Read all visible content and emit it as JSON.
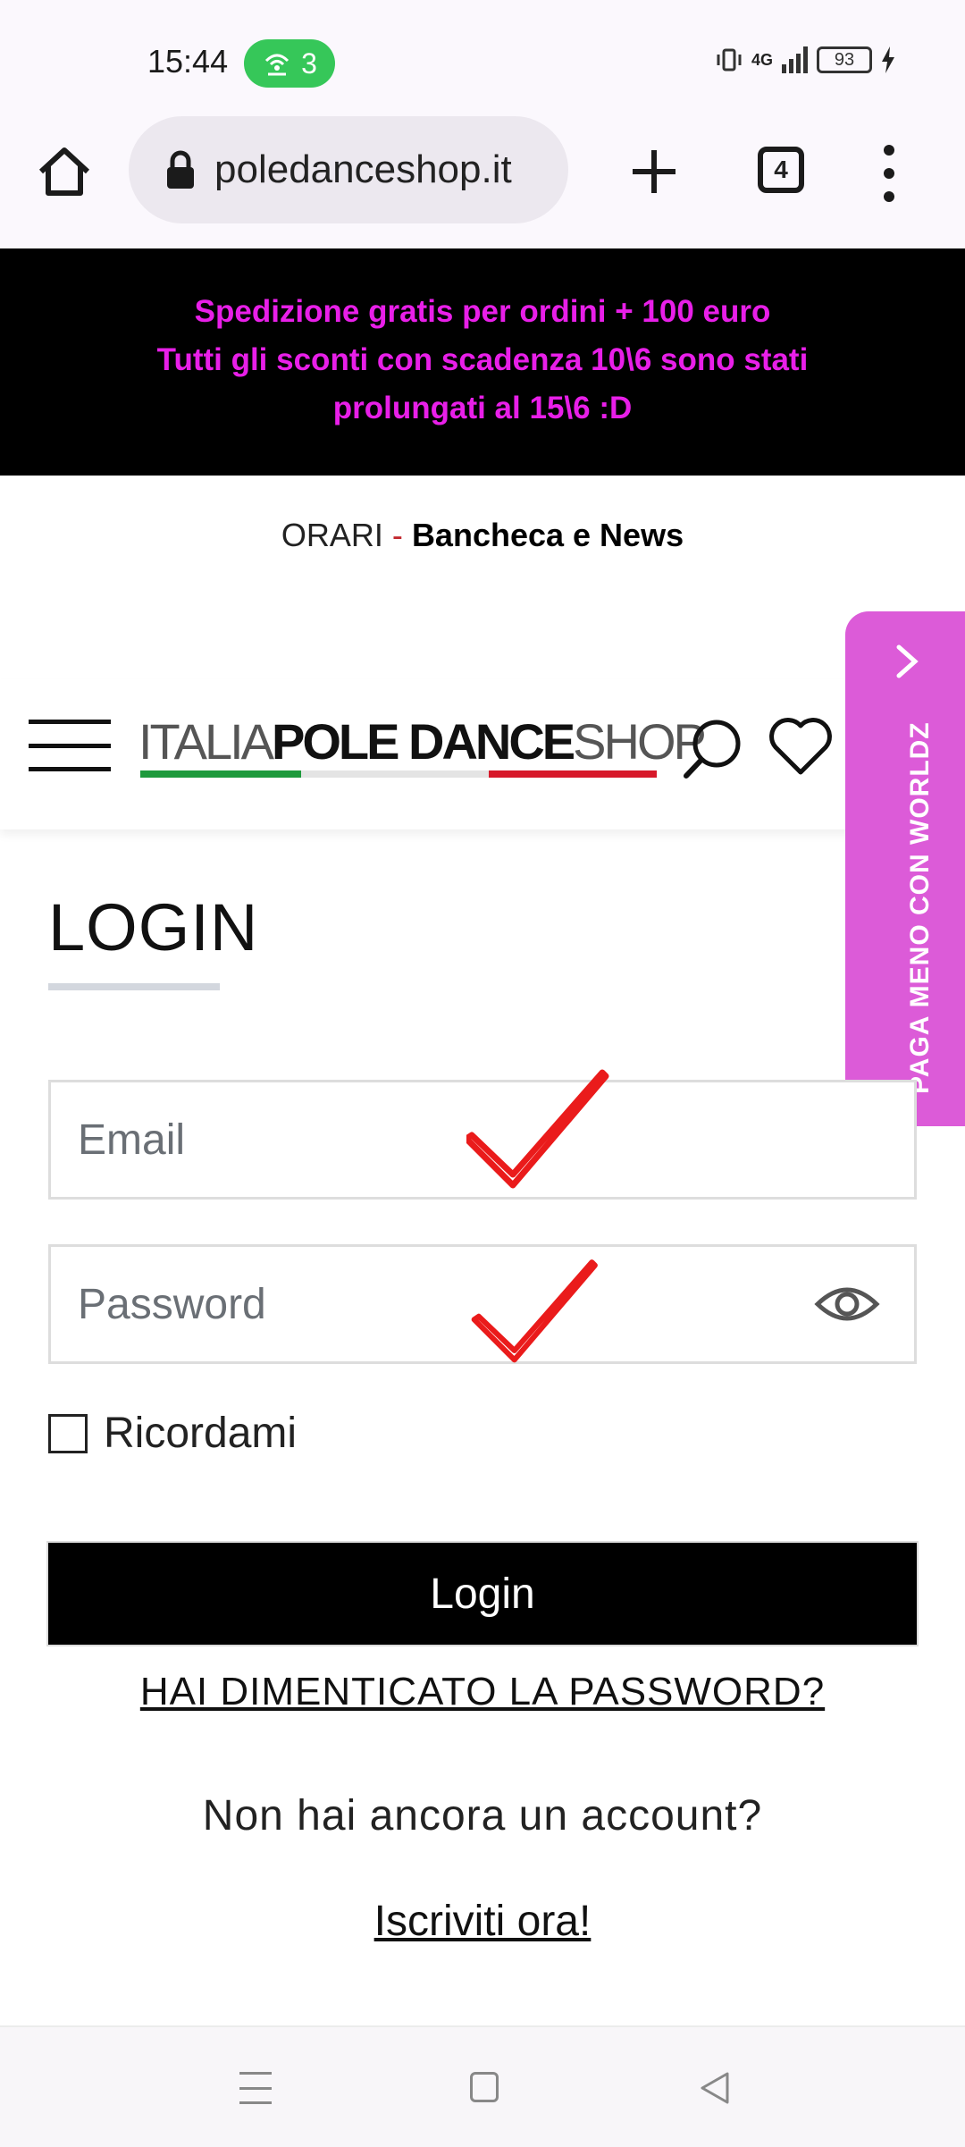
{
  "status_bar": {
    "time": "15:44",
    "hotspot_count": "3",
    "network": "4G",
    "battery": "93"
  },
  "browser": {
    "url": "poledanceshop.it",
    "tab_count": "4"
  },
  "promo": {
    "line1": "Spedizione gratis per ordini + 100 euro",
    "line2": "Tutti gli sconti con scadenza 10\\6 sono stati",
    "line3": "prolungati al 15\\6 :D",
    "color": "#e81fe8"
  },
  "info": {
    "orari": "ORARI",
    "separator": "-",
    "bancheca": "Bancheca e News"
  },
  "header": {
    "logo_thin_1": "ITALIA",
    "logo_bold": "POLE DANCE",
    "logo_thin_2": "SHOP",
    "icons": [
      "menu-icon",
      "search-icon",
      "heart-icon",
      "cart-icon"
    ]
  },
  "side_tab": {
    "label": "PAGA MENO CON WORLDZ",
    "color": "#dc5bd8"
  },
  "login": {
    "title": "LOGIN",
    "email_placeholder": "Email",
    "password_placeholder": "Password",
    "remember_label": "Ricordami",
    "button_label": "Login",
    "forgot_label": "HAI DIMENTICATO LA PASSWORD?",
    "no_account_text": "Non hai ancora un account?",
    "signup_label": "Iscriviti ora!"
  }
}
